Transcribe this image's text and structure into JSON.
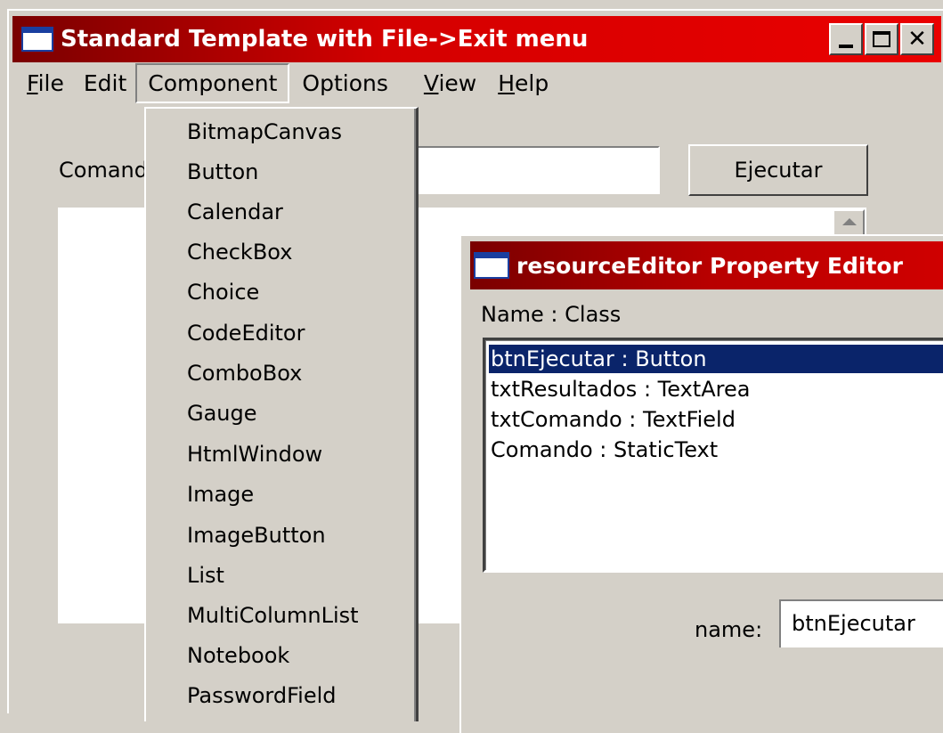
{
  "main_window": {
    "title": "Standard Template with File->Exit menu",
    "buttons": {
      "minimize": "_",
      "maximize": "□",
      "close": "✕"
    }
  },
  "menubar": {
    "items": [
      {
        "mnemonic": "F",
        "rest": "ile"
      },
      {
        "mnemonic": "",
        "rest": "Edit"
      },
      {
        "mnemonic": "",
        "rest": "Component"
      },
      {
        "mnemonic": "",
        "rest": "Options"
      },
      {
        "mnemonic": "V",
        "rest": "iew"
      },
      {
        "mnemonic": "H",
        "rest": "elp"
      }
    ],
    "open_menu": "Component"
  },
  "form": {
    "command_label": "Comando",
    "command_value": "",
    "execute_button": "Ejecutar",
    "results_value": ""
  },
  "component_menu": {
    "items": [
      "BitmapCanvas",
      "Button",
      "Calendar",
      "CheckBox",
      "Choice",
      "CodeEditor",
      "ComboBox",
      "Gauge",
      "HtmlWindow",
      "Image",
      "ImageButton",
      "List",
      "MultiColumnList",
      "Notebook",
      "PasswordField"
    ]
  },
  "property_editor": {
    "title": "resourceEditor Property Editor",
    "header": "Name  :  Class",
    "list": [
      "btnEjecutar  :  Button",
      "txtResultados  :  TextArea",
      "txtComando  :  TextField",
      "Comando  :  StaticText"
    ],
    "selected_index": 0,
    "name_label": "name:",
    "name_value": "btnEjecutar"
  },
  "colors": {
    "titlebar_active": "#d40000",
    "window_face": "#d4d0c8",
    "selection": "#0a246a"
  }
}
